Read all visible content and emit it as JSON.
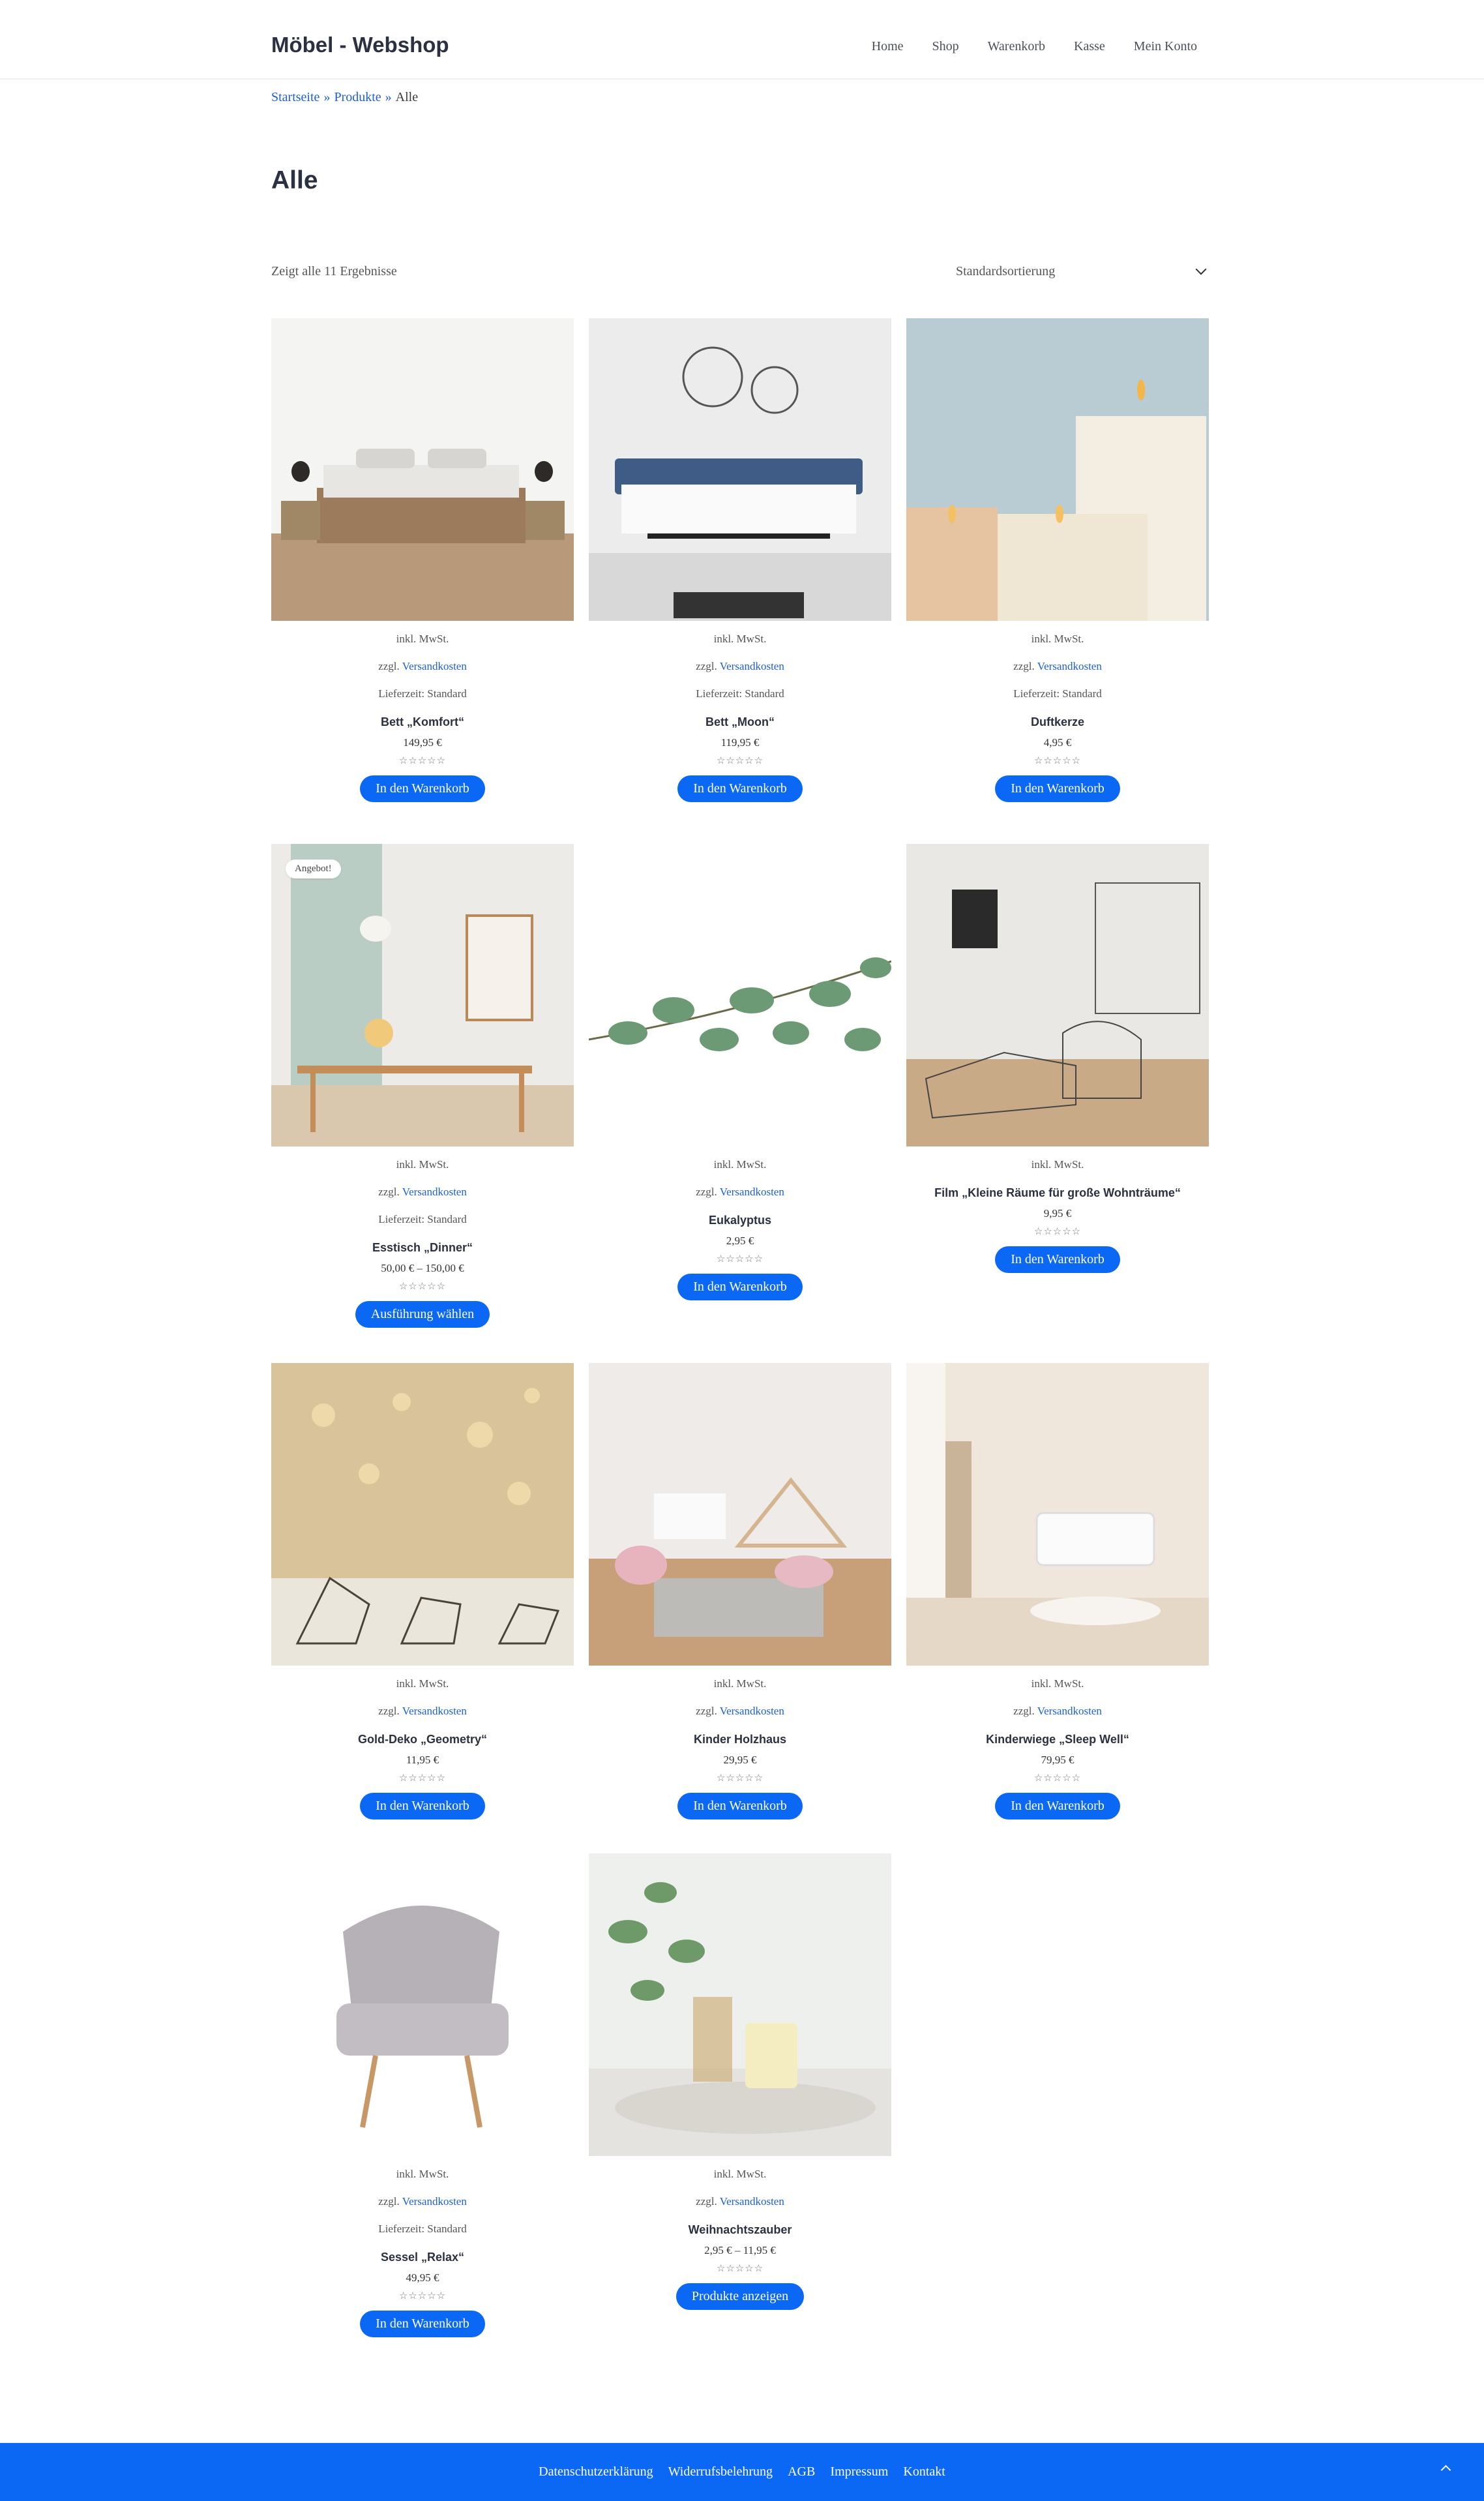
{
  "header": {
    "site_title": "Möbel - Webshop",
    "nav": [
      "Home",
      "Shop",
      "Warenkorb",
      "Kasse",
      "Mein Konto"
    ]
  },
  "breadcrumb": {
    "items": [
      "Startseite",
      "Produkte"
    ],
    "current": "Alle",
    "separator": "»"
  },
  "page_title": "Alle",
  "result_count": "Zeigt alle 11 Ergebnisse",
  "sort": {
    "selected": "Standardsortierung"
  },
  "common": {
    "tax": "inkl. MwSt.",
    "shipping_prefix": "zzgl.",
    "shipping_link": "Versandkosten",
    "delivery": "Lieferzeit: Standard",
    "stars": "☆☆☆☆☆"
  },
  "products": [
    {
      "name": "Bett „Komfort“",
      "price": "149,95 €",
      "button": "In den Warenkorb",
      "delivery": true,
      "badge": ""
    },
    {
      "name": "Bett „Moon“",
      "price": "119,95 €",
      "button": "In den Warenkorb",
      "delivery": true,
      "badge": ""
    },
    {
      "name": "Duftkerze",
      "price": "4,95 €",
      "button": "In den Warenkorb",
      "delivery": true,
      "badge": ""
    },
    {
      "name": "Esstisch „Dinner“",
      "price": "50,00 € – 150,00 €",
      "button": "Ausführung wählen",
      "delivery": true,
      "badge": "Angebot!"
    },
    {
      "name": "Eukalyptus",
      "price": "2,95 €",
      "button": "In den Warenkorb",
      "delivery": false,
      "badge": ""
    },
    {
      "name": "Film „Kleine Räume für große Wohnträume“",
      "price": "9,95 €",
      "button": "In den Warenkorb",
      "delivery": false,
      "shipping": false,
      "badge": ""
    },
    {
      "name": "Gold-Deko „Geometry“",
      "price": "11,95 €",
      "button": "In den Warenkorb",
      "delivery": false,
      "badge": ""
    },
    {
      "name": "Kinder Holzhaus",
      "price": "29,95 €",
      "button": "In den Warenkorb",
      "delivery": false,
      "badge": ""
    },
    {
      "name": "Kinderwiege „Sleep Well“",
      "price": "79,95 €",
      "button": "In den Warenkorb",
      "delivery": false,
      "badge": ""
    },
    {
      "name": "Sessel „Relax“",
      "price": "49,95 €",
      "button": "In den Warenkorb",
      "delivery": true,
      "badge": ""
    },
    {
      "name": "Weihnachtszauber",
      "price": "2,95 € – 11,95 €",
      "button": "Produkte anzeigen",
      "delivery": false,
      "badge": ""
    }
  ],
  "footer": {
    "links": [
      "Datenschutzerklärung",
      "Widerrufsbelehrung",
      "AGB",
      "Impressum",
      "Kontakt"
    ]
  },
  "colors": {
    "accent": "#0b68f4",
    "link": "#1e5fd6",
    "title": "#2b3140"
  }
}
